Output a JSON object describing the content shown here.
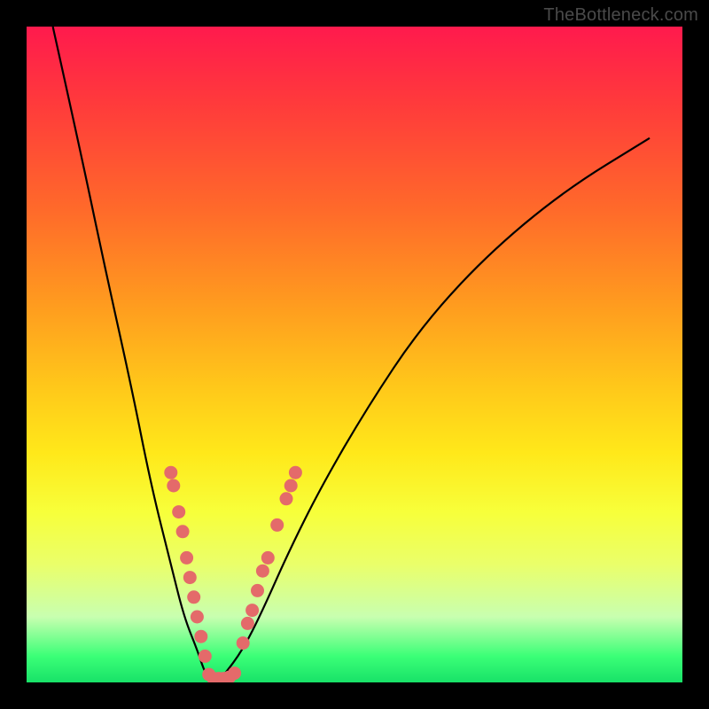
{
  "watermark": "TheBottleneck.com",
  "chart_data": {
    "type": "line",
    "title": "",
    "xlabel": "",
    "ylabel": "",
    "xlim": [
      0,
      100
    ],
    "ylim": [
      0,
      100
    ],
    "grid": false,
    "legend": false,
    "series": [
      {
        "name": "bottleneck-curve",
        "x": [
          4,
          8,
          12,
          16,
          19,
          22,
          24,
          26,
          27,
          28,
          29,
          30,
          33,
          36,
          40,
          45,
          52,
          60,
          70,
          82,
          95
        ],
        "y": [
          100,
          82,
          63,
          45,
          30,
          18,
          10,
          5,
          2,
          0,
          0,
          1,
          5,
          11,
          20,
          30,
          42,
          54,
          65,
          75,
          83
        ]
      }
    ],
    "markers": [
      {
        "name": "left-cluster",
        "color": "#e46a6a",
        "points": [
          {
            "x": 22.0,
            "y": 32
          },
          {
            "x": 22.4,
            "y": 30
          },
          {
            "x": 23.2,
            "y": 26
          },
          {
            "x": 23.8,
            "y": 23
          },
          {
            "x": 24.4,
            "y": 19
          },
          {
            "x": 24.9,
            "y": 16
          },
          {
            "x": 25.5,
            "y": 13
          },
          {
            "x": 26.0,
            "y": 10
          },
          {
            "x": 26.6,
            "y": 7
          },
          {
            "x": 27.2,
            "y": 4
          }
        ]
      },
      {
        "name": "bottom-cluster",
        "color": "#e46a6a",
        "points": [
          {
            "x": 27.8,
            "y": 1.2
          },
          {
            "x": 28.5,
            "y": 0.6
          },
          {
            "x": 29.3,
            "y": 0.6
          },
          {
            "x": 30.1,
            "y": 0.6
          },
          {
            "x": 30.9,
            "y": 0.8
          },
          {
            "x": 31.7,
            "y": 1.4
          }
        ]
      },
      {
        "name": "right-cluster",
        "color": "#e46a6a",
        "points": [
          {
            "x": 33.0,
            "y": 6
          },
          {
            "x": 33.7,
            "y": 9
          },
          {
            "x": 34.4,
            "y": 11
          },
          {
            "x": 35.2,
            "y": 14
          },
          {
            "x": 36.0,
            "y": 17
          },
          {
            "x": 36.8,
            "y": 19
          },
          {
            "x": 38.2,
            "y": 24
          },
          {
            "x": 39.6,
            "y": 28
          },
          {
            "x": 40.3,
            "y": 30
          },
          {
            "x": 41.0,
            "y": 32
          }
        ]
      }
    ],
    "gradient_stops": [
      {
        "pos": 0,
        "color": "#ff1a4d"
      },
      {
        "pos": 12,
        "color": "#ff3b3b"
      },
      {
        "pos": 28,
        "color": "#ff6a2a"
      },
      {
        "pos": 42,
        "color": "#ff9a1f"
      },
      {
        "pos": 55,
        "color": "#ffc81a"
      },
      {
        "pos": 65,
        "color": "#ffe81a"
      },
      {
        "pos": 74,
        "color": "#f7ff3a"
      },
      {
        "pos": 82,
        "color": "#eaff6a"
      },
      {
        "pos": 90,
        "color": "#c8ffb0"
      },
      {
        "pos": 96,
        "color": "#3bff77"
      },
      {
        "pos": 100,
        "color": "#18e268"
      }
    ]
  }
}
